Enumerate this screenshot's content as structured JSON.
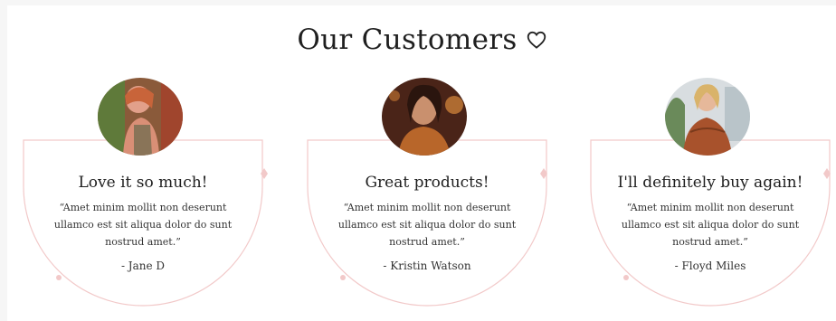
{
  "section": {
    "title": "Our Customers",
    "heart_icon": "heart-outline-icon",
    "accent_color": "#f2c9c9"
  },
  "cards": [
    {
      "title": "Love it so much!",
      "quote": "“Amet minim mollit non deserunt ullamco est sit aliqua dolor do sunt nostrud amet.”",
      "author": "- Jane D"
    },
    {
      "title": "Great products!",
      "quote": "“Amet minim mollit non deserunt ullamco est sit aliqua dolor do sunt nostrud amet.”",
      "author": "- Kristin Watson"
    },
    {
      "title": "I'll definitely buy again!",
      "quote": "“Amet minim mollit non deserunt ullamco est sit aliqua dolor do sunt nostrud amet.”",
      "author": "- Floyd Miles"
    }
  ]
}
